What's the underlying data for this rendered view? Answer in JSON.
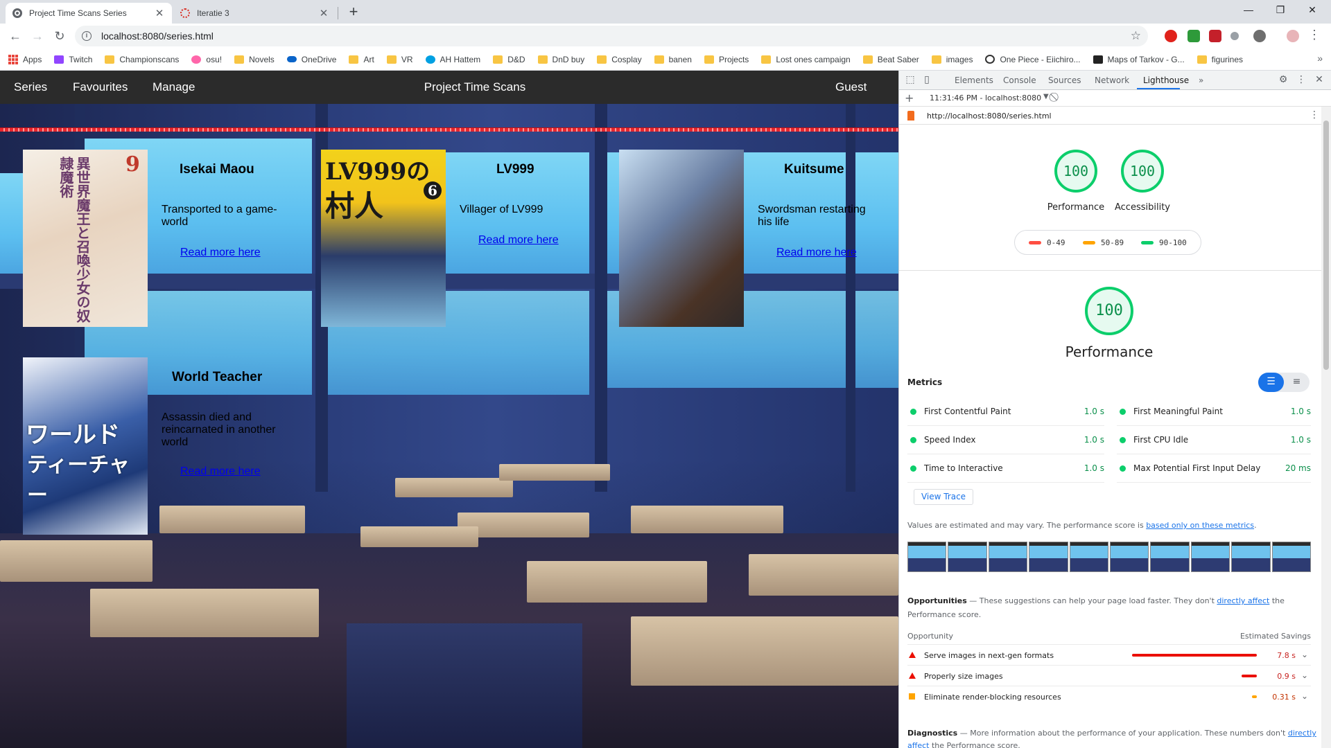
{
  "browser": {
    "tabs": [
      {
        "title": "Project Time Scans Series",
        "close": "✕"
      },
      {
        "title": "Iteratie 3",
        "close": "✕"
      }
    ],
    "new_tab": "+",
    "window_controls": {
      "minimize": "—",
      "maximize": "❐",
      "close": "✕"
    },
    "url": "localhost:8080/series.html",
    "bookmarks": [
      "Apps",
      "Twitch",
      "Championscans",
      "osu!",
      "Novels",
      "OneDrive",
      "Art",
      "VR",
      "AH Hattem",
      "D&D",
      "DnD buy",
      "Cosplay",
      "banen",
      "Projects",
      "Lost ones campaign",
      "Beat Saber",
      "images",
      "One Piece - Eiichiro...",
      "Maps of Tarkov - G...",
      "figurines"
    ],
    "bookmarks_more": "»"
  },
  "site": {
    "nav": {
      "series": "Series",
      "favourites": "Favourites",
      "manage": "Manage",
      "brand": "Project Time Scans",
      "user": "Guest"
    },
    "cards": [
      {
        "title": "Isekai Maou",
        "desc": "Transported to a game-world",
        "link": "Read more here"
      },
      {
        "title": "LV999",
        "desc": "Villager of LV999",
        "link": "Read more here"
      },
      {
        "title": "Kuitsume",
        "desc": "Swordsman restarting his life",
        "link": "Read more here"
      },
      {
        "title": "World Teacher",
        "desc": "Assassin died and reincarnated in another world",
        "link": "Read more here"
      }
    ]
  },
  "devtools": {
    "tabs": [
      "Elements",
      "Console",
      "Sources",
      "Network",
      "Lighthouse"
    ],
    "more": "»",
    "report_time": "11:31:46 PM - localhost:8080",
    "report_url": "http://localhost:8080/series.html",
    "scores": [
      {
        "label": "Performance",
        "value": "100"
      },
      {
        "label": "Accessibility",
        "value": "100"
      }
    ],
    "legend": [
      "0-49",
      "50-89",
      "90-100"
    ],
    "legend_colors": [
      "#ff4e42",
      "#ffa400",
      "#0cce6b"
    ],
    "main_score": {
      "label": "Performance",
      "value": "100"
    },
    "metrics_title": "Metrics",
    "metrics": [
      {
        "name": "First Contentful Paint",
        "value": "1.0 s"
      },
      {
        "name": "First Meaningful Paint",
        "value": "1.0 s"
      },
      {
        "name": "Speed Index",
        "value": "1.0 s"
      },
      {
        "name": "First CPU Idle",
        "value": "1.0 s"
      },
      {
        "name": "Time to Interactive",
        "value": "1.0 s"
      },
      {
        "name": "Max Potential First Input Delay",
        "value": "20 ms"
      }
    ],
    "view_trace": "View Trace",
    "note_text": "Values are estimated and may vary. The performance score is ",
    "note_link": "based only on these metrics",
    "note_end": ".",
    "opportunities": {
      "title": "Opportunities",
      "desc_a": " — These suggestions can help your page load faster. They don't ",
      "desc_link": "directly affect",
      "desc_b": " the Performance score.",
      "col_opportunity": "Opportunity",
      "col_savings": "Estimated Savings",
      "items": [
        {
          "name": "Serve images in next-gen formats",
          "value": "7.8 s",
          "fraction": 1.0
        },
        {
          "name": "Properly size images",
          "value": "0.9 s",
          "fraction": 0.12
        },
        {
          "name": "Eliminate render-blocking resources",
          "value": "0.31 s",
          "fraction": 0.04
        }
      ]
    },
    "diagnostics": {
      "title": "Diagnostics",
      "desc_a": " — More information about the performance of your application. These numbers don't ",
      "desc_link": "directly affect",
      "desc_b": " the Performance score."
    }
  }
}
